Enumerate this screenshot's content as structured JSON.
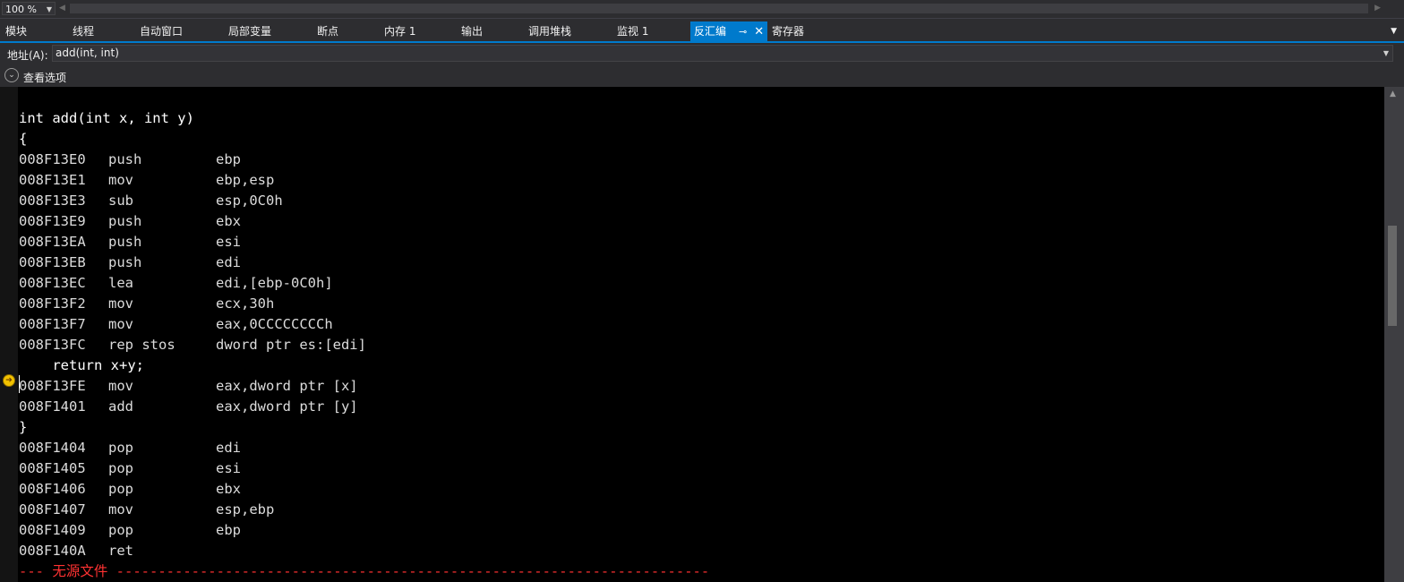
{
  "zoom": {
    "value": "100 %"
  },
  "tabs": [
    {
      "label": "模块"
    },
    {
      "label": "线程"
    },
    {
      "label": "自动窗口"
    },
    {
      "label": "局部变量"
    },
    {
      "label": "断点"
    },
    {
      "label": "内存 1"
    },
    {
      "label": "输出"
    },
    {
      "label": "调用堆栈"
    },
    {
      "label": "监视 1"
    },
    {
      "label": "反汇编"
    },
    {
      "label": "寄存器"
    }
  ],
  "address": {
    "label": "地址(A):",
    "value": "add(int, int)"
  },
  "options": {
    "label": "查看选项"
  },
  "disassembly": {
    "lines": [
      {
        "kind": "src",
        "text": "int add(int x, int y)"
      },
      {
        "kind": "src",
        "text": "{"
      },
      {
        "kind": "asm",
        "addr": "008F13E0",
        "op": "push",
        "args": "ebp"
      },
      {
        "kind": "asm",
        "addr": "008F13E1",
        "op": "mov",
        "args": "ebp,esp"
      },
      {
        "kind": "asm",
        "addr": "008F13E3",
        "op": "sub",
        "args": "esp,0C0h"
      },
      {
        "kind": "asm",
        "addr": "008F13E9",
        "op": "push",
        "args": "ebx"
      },
      {
        "kind": "asm",
        "addr": "008F13EA",
        "op": "push",
        "args": "esi"
      },
      {
        "kind": "asm",
        "addr": "008F13EB",
        "op": "push",
        "args": "edi"
      },
      {
        "kind": "asm",
        "addr": "008F13EC",
        "op": "lea",
        "args": "edi,[ebp-0C0h]"
      },
      {
        "kind": "asm",
        "addr": "008F13F2",
        "op": "mov",
        "args": "ecx,30h"
      },
      {
        "kind": "asm",
        "addr": "008F13F7",
        "op": "mov",
        "args": "eax,0CCCCCCCCh"
      },
      {
        "kind": "asm",
        "addr": "008F13FC",
        "op": "rep stos",
        "args": "dword ptr es:[edi]"
      },
      {
        "kind": "src",
        "text": "    return x+y;"
      },
      {
        "kind": "asm",
        "addr": "008F13FE",
        "op": "mov",
        "args": "eax,dword ptr [x]",
        "current": true
      },
      {
        "kind": "asm",
        "addr": "008F1401",
        "op": "add",
        "args": "eax,dword ptr [y]"
      },
      {
        "kind": "src",
        "text": "}"
      },
      {
        "kind": "asm",
        "addr": "008F1404",
        "op": "pop",
        "args": "edi"
      },
      {
        "kind": "asm",
        "addr": "008F1405",
        "op": "pop",
        "args": "esi"
      },
      {
        "kind": "asm",
        "addr": "008F1406",
        "op": "pop",
        "args": "ebx"
      },
      {
        "kind": "asm",
        "addr": "008F1407",
        "op": "mov",
        "args": "esp,ebp"
      },
      {
        "kind": "asm",
        "addr": "008F1409",
        "op": "pop",
        "args": "ebp"
      },
      {
        "kind": "asm",
        "addr": "008F140A",
        "op": "ret",
        "args": ""
      },
      {
        "kind": "separator",
        "text": "--- 无源文件 -----------------------------------------------------------------------"
      }
    ]
  },
  "icons": {
    "zoom_dropdown": "chevron-down-icon",
    "pin": "pin-icon",
    "close": "close-icon",
    "options_toggle": "chevron-circle-down-icon",
    "instruction_pointer": "current-instruction-arrow-icon"
  },
  "colors": {
    "accent": "#007acc",
    "background": "#2d2d30",
    "code_background": "#000000",
    "source_text": "#ffffff",
    "asm_text": "#dcdcdc",
    "separator_text": "#ff3232",
    "ip_marker": "#f2c200"
  }
}
